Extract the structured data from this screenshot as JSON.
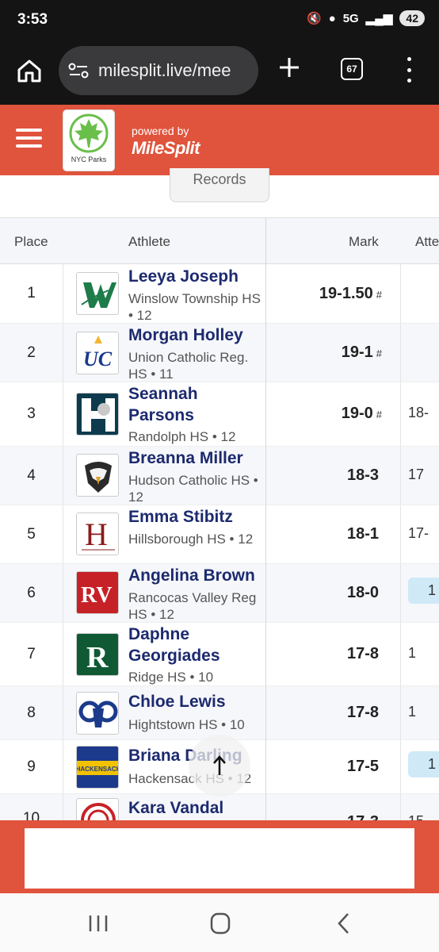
{
  "status_bar": {
    "time": "3:53",
    "network": "5G",
    "battery": "42"
  },
  "browser": {
    "url": "milesplit.live/mee",
    "tab_count": "67"
  },
  "site_header": {
    "logo_text": "NYC Parks",
    "powered_by": "powered by",
    "brand": "MileSplit"
  },
  "records_tab": "Records",
  "table": {
    "headers": {
      "place": "Place",
      "athlete": "Athlete",
      "mark": "Mark",
      "attempts": "Atte"
    },
    "rows": [
      {
        "place": "1",
        "name": "Leeya Joseph",
        "meta": "Winslow Township HS • 12",
        "mark": "19-1.50",
        "flag": "#",
        "att": ""
      },
      {
        "place": "2",
        "name": "Morgan Holley",
        "meta": "Union Catholic Reg. HS • 11",
        "mark": "19-1",
        "flag": "#",
        "att": ""
      },
      {
        "place": "3",
        "name": "Seannah Parsons",
        "meta": "Randolph HS • 12",
        "mark": "19-0",
        "flag": "#",
        "att": "18-"
      },
      {
        "place": "4",
        "name": "Breanna Miller",
        "meta": "Hudson Catholic HS • 12",
        "mark": "18-3",
        "flag": "",
        "att": "17"
      },
      {
        "place": "5",
        "name": "Emma Stibitz",
        "meta": "Hillsborough HS • 12",
        "mark": "18-1",
        "flag": "",
        "att": "17-"
      },
      {
        "place": "6",
        "name": "Angelina Brown",
        "meta": "Rancocas Valley Reg HS • 12",
        "mark": "18-0",
        "flag": "",
        "att": "1"
      },
      {
        "place": "7",
        "name": "Daphne Georgiades",
        "meta": "Ridge HS • 10",
        "mark": "17-8",
        "flag": "",
        "att": "1"
      },
      {
        "place": "8",
        "name": "Chloe Lewis",
        "meta": "Hightstown HS • 10",
        "mark": "17-8",
        "flag": "",
        "att": "1"
      },
      {
        "place": "9",
        "name": "Briana Darling",
        "meta": "Hackensack HS • 12",
        "mark": "17-5",
        "flag": "",
        "att": "1"
      },
      {
        "place": "10",
        "name": "Kara Vandal",
        "meta": "",
        "mark": "17-3",
        "flag": "",
        "att": "15"
      }
    ]
  },
  "team_logos": [
    "winslow-w-logo",
    "union-catholic-logo",
    "randolph-ram-logo",
    "hudson-eagle-logo",
    "hillsborough-h-logo",
    "rancocas-valley-logo",
    "ridge-r-logo",
    "hightstown-ram-logo",
    "hackensack-logo",
    "team-logo"
  ],
  "hackensack_logo_text": "HACKENSACK",
  "colors": {
    "brand_red": "#e0533c",
    "athlete_name": "#1c2a6e",
    "highlight": "#cfe9f7"
  }
}
